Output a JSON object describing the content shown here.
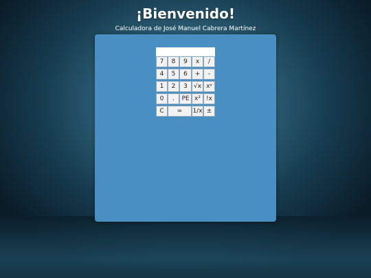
{
  "header": {
    "title": "¡Bienvenido!",
    "subtitle": "Calculadora de José Manuel Cabrera Martínez"
  },
  "calculator": {
    "display_value": "",
    "rows": [
      [
        "7",
        "8",
        "9",
        "x",
        "/"
      ],
      [
        "4",
        "5",
        "6",
        "+",
        "-"
      ],
      [
        "1",
        "2",
        "3",
        "√x",
        "xʸ"
      ],
      [
        "0",
        ".",
        "PE",
        "x²",
        "!x"
      ],
      [
        "C",
        "=",
        "1/x",
        "±"
      ]
    ]
  },
  "colors": {
    "panel": "#4a8fc2",
    "key": "#f2f2f2",
    "display": "#ffffff"
  }
}
